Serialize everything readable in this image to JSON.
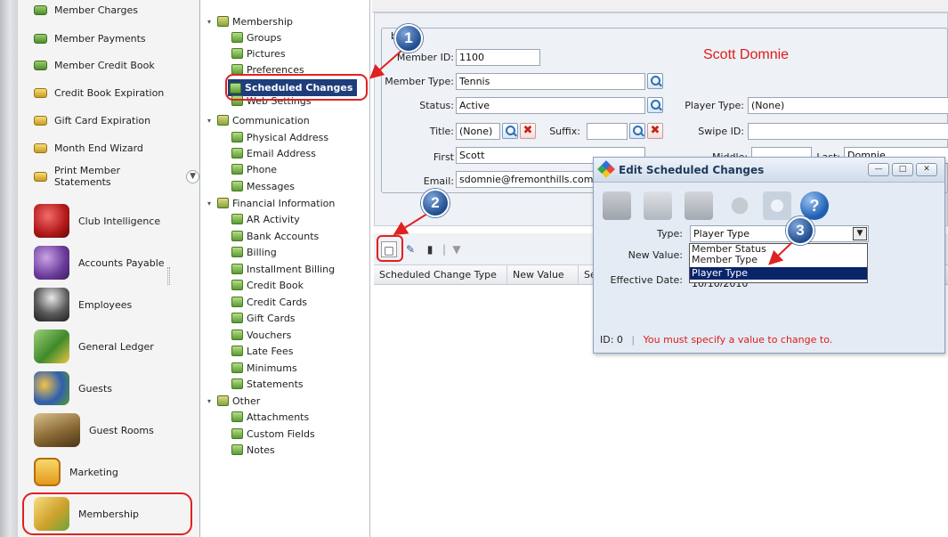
{
  "nav": {
    "small_items": [
      {
        "label": "Member Charges"
      },
      {
        "label": "Member Payments"
      },
      {
        "label": "Member Credit Book"
      },
      {
        "label": "Credit Book Expiration"
      },
      {
        "label": "Gift Card Expiration"
      },
      {
        "label": "Month End Wizard"
      },
      {
        "label": "Print Member Statements"
      }
    ],
    "big_items": [
      {
        "label": "Club Intelligence"
      },
      {
        "label": "Accounts Payable"
      },
      {
        "label": "Employees"
      },
      {
        "label": "General Ledger"
      },
      {
        "label": "Guests"
      },
      {
        "label": "Guest Rooms"
      },
      {
        "label": "Marketing"
      },
      {
        "label": "Membership"
      }
    ]
  },
  "tree": {
    "membership": {
      "label": "Membership",
      "children": [
        "Groups",
        "Pictures",
        "Preferences",
        "Scheduled Changes",
        "Web Settings"
      ]
    },
    "communication": {
      "label": "Communication",
      "children": [
        "Physical Address",
        "Email Address",
        "Phone",
        "Messages"
      ]
    },
    "financial": {
      "label": "Financial Information",
      "children": [
        "AR Activity",
        "Bank Accounts",
        "Billing",
        "Installment Billing",
        "Credit Book",
        "Credit Cards",
        "Gift Cards",
        "Vouchers",
        "Late Fees",
        "Minimums",
        "Statements"
      ]
    },
    "other": {
      "label": "Other",
      "children": [
        "Attachments",
        "Custom Fields",
        "Notes"
      ]
    }
  },
  "form": {
    "group_title": "ber",
    "member_name": "Scott Domnie",
    "member_id_label": "Member ID:",
    "member_id": "1100",
    "member_type_label": "Member Type:",
    "member_type": "Tennis",
    "status_label": "Status:",
    "status": "Active",
    "player_type_label": "Player Type:",
    "player_type": "(None)",
    "title_label": "Title:",
    "title": "(None)",
    "suffix_label": "Suffix:",
    "suffix": "",
    "swipe_id_label": "Swipe ID:",
    "swipe_id": "",
    "first_label": "First",
    "first": "Scott",
    "middle_label": "Middle:",
    "middle": "",
    "last_label": "Last:",
    "last": "Domnie",
    "email_label": "Email:",
    "email": "sdomnie@fremonthills.com"
  },
  "grid": {
    "columns": [
      "Scheduled Change Type",
      "New Value",
      "Se"
    ]
  },
  "dialog": {
    "title": "Edit Scheduled Changes",
    "type_label": "Type:",
    "type_value": "Player Type",
    "new_value_label": "New Value:",
    "effective_date_label": "Effective Date:",
    "effective_date_partial": "10/10/2010",
    "options": [
      "Member Status",
      "Member Type",
      "Player Type"
    ],
    "id_text": "ID: 0",
    "separator": "|",
    "error_text": "You must specify a value to change to."
  },
  "callouts": [
    "1",
    "2",
    "3"
  ],
  "colors": {
    "accent_red": "#e01b1b",
    "selection_navy": "#1f3d7a",
    "badge_blue": "#1f4d8f",
    "dropdown_highlight": "#0a246a"
  }
}
